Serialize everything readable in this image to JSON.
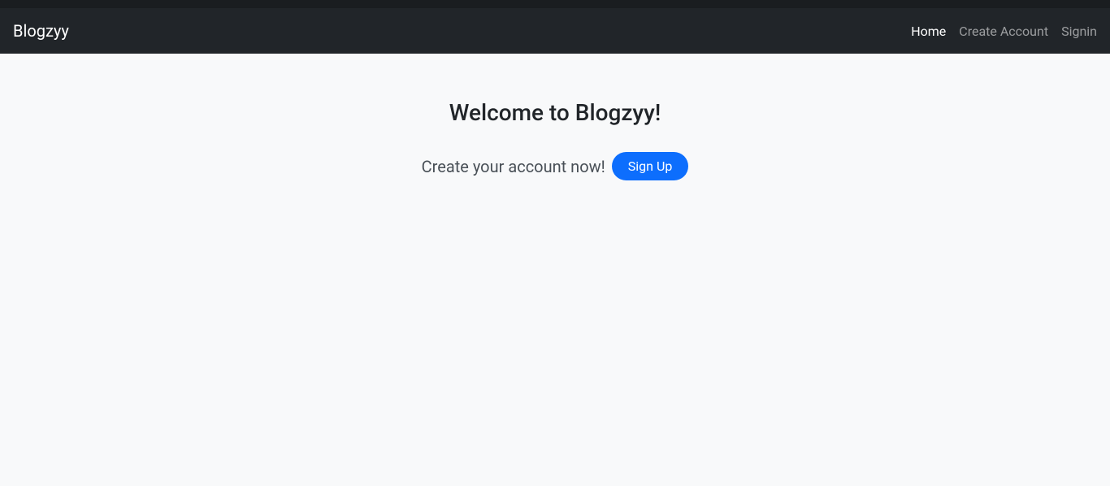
{
  "navbar": {
    "brand": "Blogzyy",
    "links": [
      {
        "label": "Home",
        "active": true
      },
      {
        "label": "Create Account",
        "active": false
      },
      {
        "label": "Signin",
        "active": false
      }
    ]
  },
  "main": {
    "heading": "Welcome to Blogzyy!",
    "cta_text": "Create your account now!",
    "signup_button": "Sign Up"
  }
}
